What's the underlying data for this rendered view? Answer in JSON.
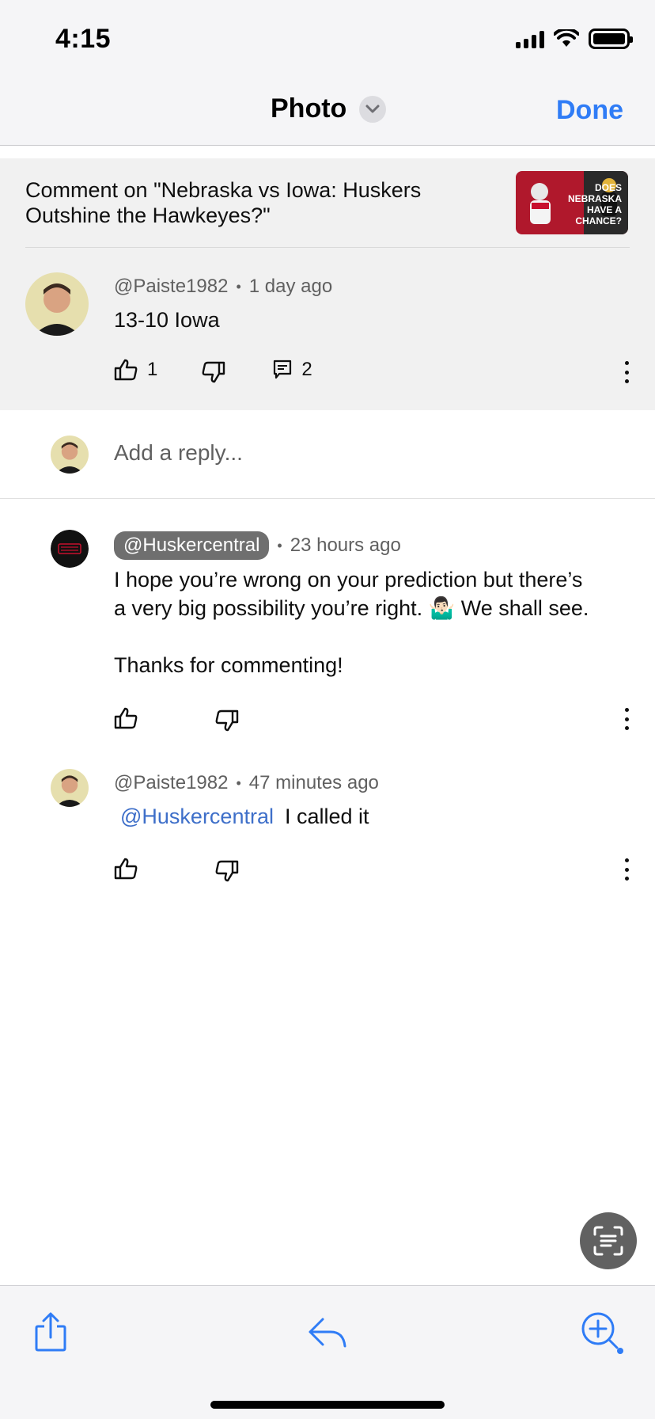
{
  "status_bar": {
    "time": "4:15"
  },
  "nav": {
    "title": "Photo",
    "done_label": "Done"
  },
  "video": {
    "title": "Comment on \"Nebraska vs Iowa: Huskers Outshine the Hawkeyes?\"",
    "thumbnail_text": "DOES NEBRASKA HAVE A CHANCE?"
  },
  "top_comment": {
    "author": "@Paiste1982",
    "time": "1 day ago",
    "text": "13-10 Iowa",
    "likes": "1",
    "replies": "2"
  },
  "reply_input": {
    "placeholder": "Add a reply..."
  },
  "replies": [
    {
      "author": "@Huskercentral",
      "time": "23 hours ago",
      "text_line1": "I hope you’re wrong on your prediction but there’s",
      "text_line2": "a very big possibility you’re right. 🤷🏻‍♂️  We shall see.",
      "text_line3": "Thanks for commenting!"
    },
    {
      "author": "@Paiste1982",
      "time": "47 minutes ago",
      "mention": "@Huskercentral",
      "text": "I called it"
    }
  ],
  "colors": {
    "accent_blue": "#2f7cf6",
    "mention_blue": "#3e6fc9",
    "chip_gray": "#6f6f6f",
    "header_bg": "#f1f1f1"
  },
  "icons": {
    "like": "thumbs-up-icon",
    "dislike": "thumbs-down-icon",
    "reply": "comment-icon",
    "more": "more-vertical-icon",
    "share": "share-icon",
    "reply_toolbar": "reply-arrow-icon",
    "zoom": "zoom-in-icon",
    "lens": "text-scan-icon"
  }
}
